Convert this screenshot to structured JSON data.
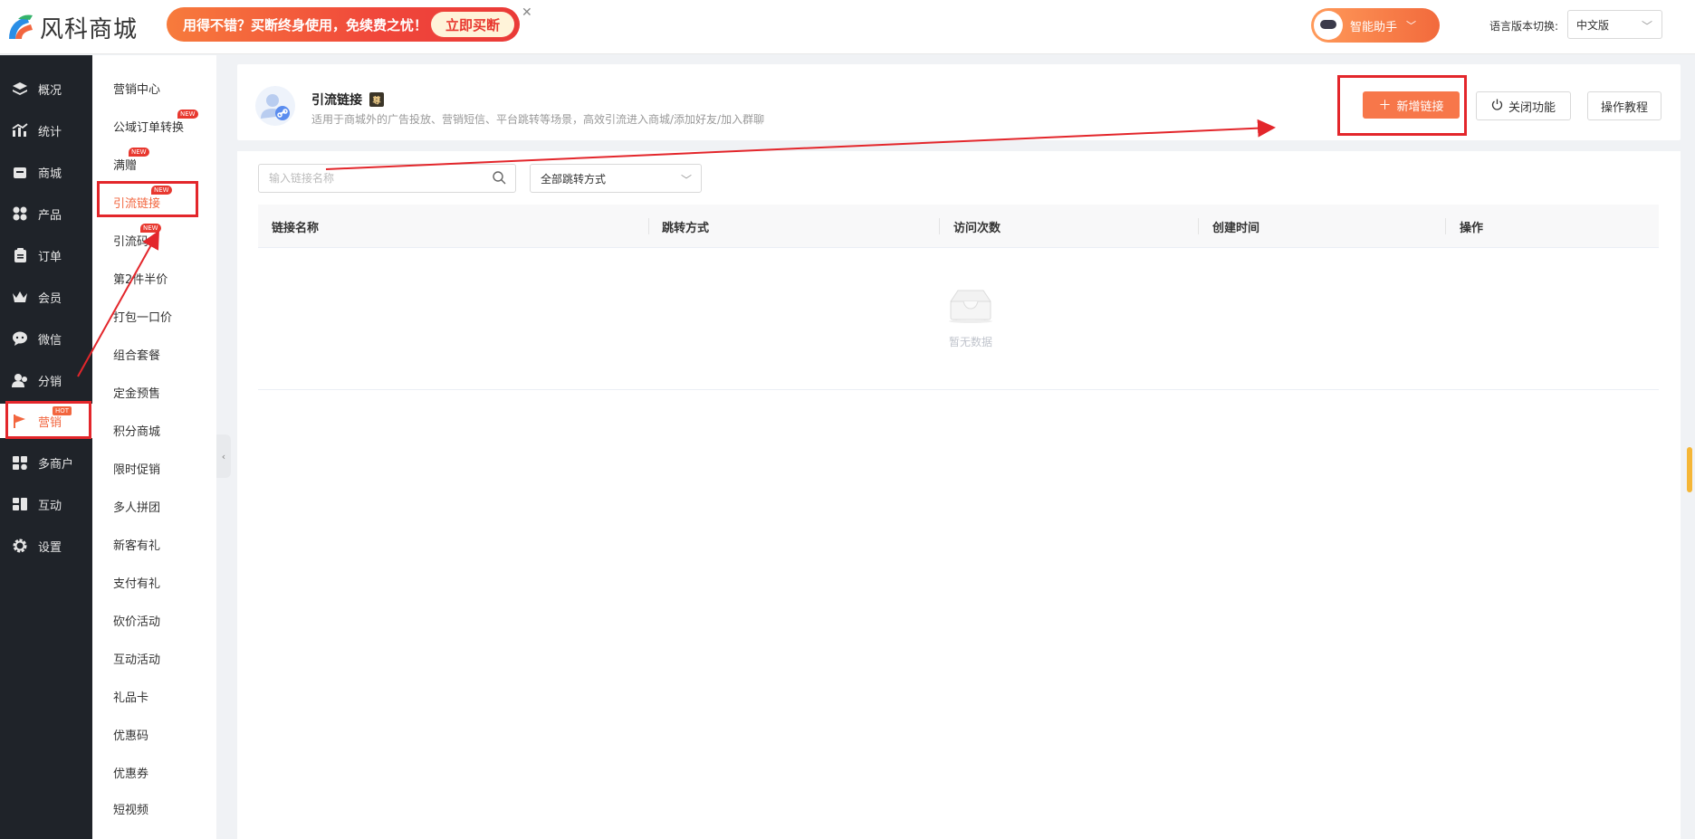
{
  "header": {
    "logo_text": "风科商城",
    "promo_text": "用得不错？买断终身使用，免续费之忧！",
    "promo_button": "立即买断",
    "assistant_label": "智能助手",
    "language_label": "语言版本切换:",
    "language_value": "中文版"
  },
  "sidebar": {
    "items": [
      {
        "label": "概况",
        "icon": "layers-icon"
      },
      {
        "label": "统计",
        "icon": "chart-icon"
      },
      {
        "label": "商城",
        "icon": "store-icon"
      },
      {
        "label": "产品",
        "icon": "grid-icon"
      },
      {
        "label": "订单",
        "icon": "clipboard-icon"
      },
      {
        "label": "会员",
        "icon": "crown-icon"
      },
      {
        "label": "微信",
        "icon": "wechat-icon"
      },
      {
        "label": "分销",
        "icon": "users-icon"
      },
      {
        "label": "营销",
        "icon": "flag-icon",
        "badge": "HOT"
      },
      {
        "label": "多商户",
        "icon": "merchant-icon"
      },
      {
        "label": "互动",
        "icon": "interact-icon"
      },
      {
        "label": "设置",
        "icon": "gear-icon"
      }
    ]
  },
  "submenu": {
    "items": [
      {
        "label": "营销中心"
      },
      {
        "label": "公域订单转换",
        "badge": "NEW"
      },
      {
        "label": "满赠",
        "badge": "NEW"
      },
      {
        "label": "引流链接",
        "badge": "NEW"
      },
      {
        "label": "引流码",
        "badge": "NEW"
      },
      {
        "label": "第2件半价"
      },
      {
        "label": "打包一口价"
      },
      {
        "label": "组合套餐"
      },
      {
        "label": "定金预售"
      },
      {
        "label": "积分商城"
      },
      {
        "label": "限时促销"
      },
      {
        "label": "多人拼团"
      },
      {
        "label": "新客有礼"
      },
      {
        "label": "支付有礼"
      },
      {
        "label": "砍价活动"
      },
      {
        "label": "互动活动"
      },
      {
        "label": "礼品卡"
      },
      {
        "label": "优惠码"
      },
      {
        "label": "优惠券"
      },
      {
        "label": "短视频"
      }
    ]
  },
  "page": {
    "title": "引流链接",
    "description": "适用于商城外的广告投放、营销短信、平台跳转等场景，高效引流进入商城/添加好友/加入群聊",
    "new_button": "新增链接",
    "close_button": "关闭功能",
    "tutorial_button": "操作教程",
    "vip_mark": "尊"
  },
  "filters": {
    "search_placeholder": "输入链接名称",
    "jump_select": "全部跳转方式"
  },
  "table": {
    "columns": [
      "链接名称",
      "跳转方式",
      "访问次数",
      "创建时间",
      "操作"
    ],
    "empty_text": "暂无数据"
  },
  "colors": {
    "accent": "#f7774a",
    "sidebar_bg": "#1f2329",
    "annotation": "#e3262b"
  }
}
